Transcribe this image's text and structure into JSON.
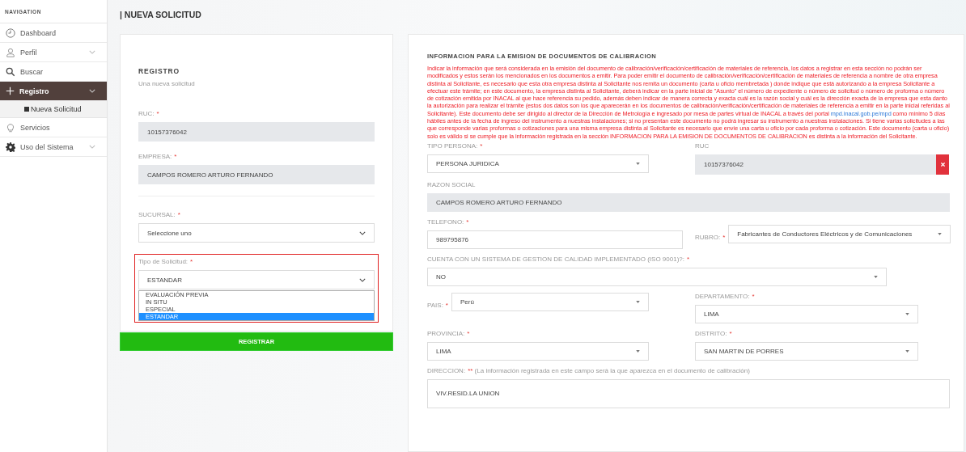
{
  "sidebar": {
    "heading": "NAVIGATION",
    "items": [
      {
        "label": "Dashboard",
        "expandable": false,
        "selected": false
      },
      {
        "label": "Perfil",
        "expandable": true,
        "selected": false
      },
      {
        "label": "Buscar",
        "expandable": false,
        "selected": false
      },
      {
        "label": "Registro",
        "expandable": true,
        "selected": true,
        "children": [
          {
            "label": "Nueva Solicitud",
            "selected": true
          }
        ]
      },
      {
        "label": "Servicios",
        "expandable": false,
        "selected": false
      },
      {
        "label": "Uso del Sistema",
        "expandable": true,
        "selected": false
      }
    ]
  },
  "page_title": "| NUEVA SOLICITUD",
  "registro": {
    "title": "REGISTRO",
    "subtitle": "Una nueva solicitud",
    "ruc": {
      "label": "RUC:",
      "mark": "*",
      "value": "10157376042"
    },
    "empresa": {
      "label": "EMPRESA:",
      "mark": "*",
      "value": "CAMPOS ROMERO ARTURO FERNANDO"
    },
    "sucursal": {
      "label": "SUCURSAL:",
      "mark": "*",
      "value": "Seleccione uno"
    },
    "tipo_solicitud": {
      "label": "Tipo de Solicitud:",
      "mark": "*",
      "value": "ESTANDAR",
      "highlighted": true,
      "options": [
        {
          "label": "EVALUACIÓN PREVIA",
          "selected": false
        },
        {
          "label": "IN SITU",
          "selected": false
        },
        {
          "label": "ESPECIAL",
          "selected": false
        },
        {
          "label": "ESTANDAR",
          "selected": true
        }
      ]
    },
    "submit": "REGISTRAR"
  },
  "informacion": {
    "title": "INFORMACION PARA LA EMISION DE DOCUMENTOS DE CALIBRACION",
    "notice_before": "Indicar la información que será considerada en la emisión del documento de calibración/verificación/certificación de materiales de referencia, los datos a registrar en esta sección no podrán ser modificados y estos serán los mencionados en los documentos a emitir. Para poder emitir el documento de calibración/verificación/certificación de materiales de referencia a nombre de otra empresa distinta al Solicitante, es necesario que esta otra empresa distinta al Solicitante nos remita un documento (carta u oficio membretada ) donde indique que está autorizando a la empresa Solicitante a efectuar este trámite; en este documento, la empresa distinta al Solicitante, deberá indicar en la parte inicial de \"Asunto\" el número de expediente o número de solicitud o número de proforma o número de cotización emitida por INACAL al que hace referencia su pedido, además deben indicar de manera correcta y exacta cuál es la razón social y cuál es la dirección exacta de la empresa que esta danto la autorización para realizar el trámite (estos dos datos son los que aparecerán en los documentos de calibración/verificación/certificación de materiales de referencia a emitir en la parte inicial referidas al Solicitante). Este documento debe ser dirigido al director de la Dirección de Metrología e ingresado por mesa de partes virtual de INACAL a través del portal ",
    "notice_link": "mpd.inacal.gob.pe/mpd",
    "notice_after": " como mínimo 5 días hábiles antes de la fecha de ingreso del instrumento a nuestras instalaciones; si no presentan este documento no podrá ingresar su instrumento a nuestras instalaciones. Si tiene varias solicitudes a las que corresponde varias proformas o cotizaciones para una misma empresa distinta al Solicitante es necesario que envíe una carta u oficio por cada proforma o cotización. Este documento (carta u oficio) solo es válido si se cumple que la información registrada en la sección INFORMACION PARA LA EMISION DE DOCUMENTOS DE CALIBRACION es distinta a la información del Solicitante.",
    "tipo_persona": {
      "label": "TIPO PERSONA:",
      "mark": "*",
      "value": "PERSONA JURIDICA"
    },
    "ruc": {
      "label": "RUC",
      "value": "10157376042"
    },
    "razon_social": {
      "label": "RAZON SOCIAL",
      "value": "CAMPOS ROMERO ARTURO FERNANDO"
    },
    "telefono": {
      "label": "TELEFONO:",
      "mark": "*",
      "value": "989795876"
    },
    "rubro": {
      "label": "RUBRO:",
      "mark": "*",
      "value": "Fabricantes de Conductores Eléctricos y de Comunicaciones"
    },
    "iso": {
      "label": "CUENTA CON UN SISTEMA DE GESTION DE CALIDAD IMPLEMENTADO (ISO 9001)?:",
      "mark": "*",
      "value": "NO"
    },
    "pais": {
      "label": "PAIS:",
      "mark": "*",
      "value": "Perú"
    },
    "departamento": {
      "label": "DEPARTAMENTO:",
      "mark": "*",
      "value": "LIMA"
    },
    "provincia": {
      "label": "PROVINCIA:",
      "mark": "*",
      "value": "LIMA"
    },
    "distrito": {
      "label": "DISTRITO:",
      "mark": "*",
      "value": "SAN MARTIN DE PORRES"
    },
    "direccion": {
      "label": "DIRECCION:",
      "mark": "**",
      "note": "(La información registrada en este campo será la que aparezca en el documento de calibración)",
      "value": "VIV.RESID.LA UNION"
    }
  }
}
